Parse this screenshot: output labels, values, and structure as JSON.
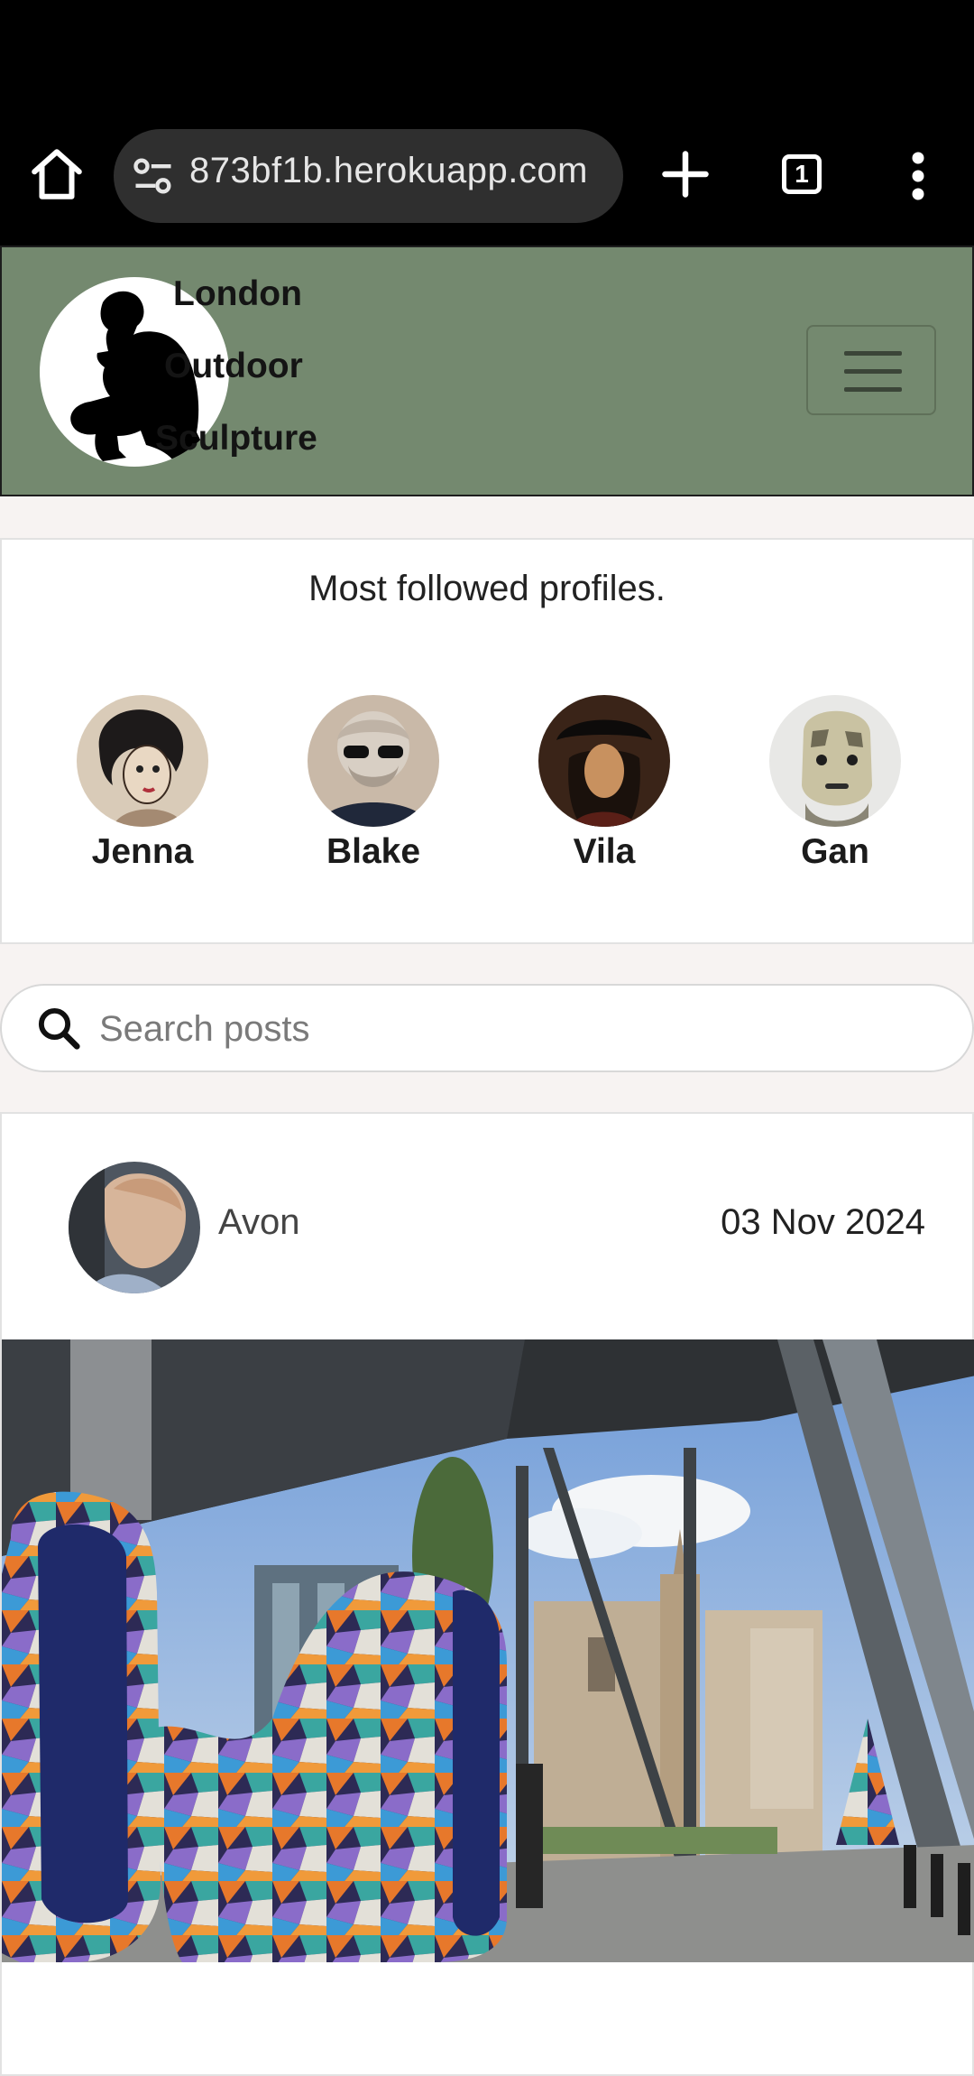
{
  "browser": {
    "url": "873bf1b.herokuapp.com",
    "tab_count": "1"
  },
  "header": {
    "brand_lines": [
      "London",
      "Outdoor",
      "Sculpture"
    ]
  },
  "followed": {
    "heading": "Most followed profiles.",
    "profiles": [
      {
        "name": "Jenna"
      },
      {
        "name": "Blake"
      },
      {
        "name": "Vila"
      },
      {
        "name": "Gan"
      }
    ]
  },
  "search": {
    "placeholder": "Search posts",
    "value": ""
  },
  "post": {
    "author": "Avon",
    "date": "03 Nov 2024"
  },
  "colors": {
    "header_bg": "#74896f",
    "page_bg": "#f7f3f2",
    "chrome_bg": "#000000"
  }
}
